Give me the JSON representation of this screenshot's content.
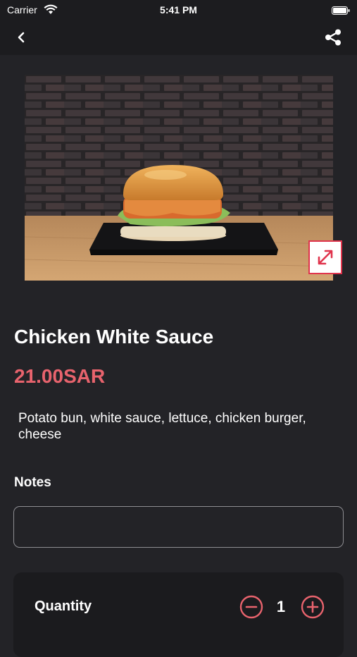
{
  "status_bar": {
    "carrier": "Carrier",
    "time": "5:41 PM",
    "icons": [
      "wifi-icon",
      "battery-icon"
    ]
  },
  "nav": {
    "back_icon": "chevron-left-icon",
    "share_icon": "share-icon"
  },
  "product": {
    "image_alt_icon": "burger-photo",
    "expand_icon": "expand-arrows-icon",
    "name": "Chicken White Sauce",
    "price": "21.00SAR",
    "description": "Potato bun, white sauce, lettuce, chicken burger, cheese"
  },
  "notes": {
    "label": "Notes",
    "value": "",
    "placeholder": ""
  },
  "quantity": {
    "label": "Quantity",
    "value": "1",
    "minus_icon": "minus-circle-icon",
    "plus_icon": "plus-circle-icon"
  },
  "colors": {
    "background": "#232327",
    "bar": "#1c1c1f",
    "accent": "#e8636d",
    "expand_border": "#e0344d"
  }
}
